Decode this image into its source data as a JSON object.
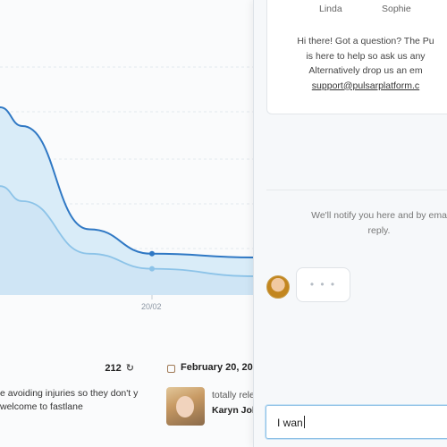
{
  "chart_data": {
    "type": "area",
    "x_ticks": [
      "20/02"
    ],
    "title": "",
    "xlabel": "",
    "ylabel": "",
    "series": [
      {
        "values": [
          1.0,
          0.9,
          0.35,
          0.22,
          0.2
        ]
      },
      {
        "values": [
          0.58,
          0.5,
          0.22,
          0.14,
          0.1
        ]
      }
    ],
    "colors": {
      "line_main": "#2f78c4",
      "line_secondary": "#8cc3e8",
      "area": "#d9ecf8"
    },
    "grid": true
  },
  "feed": {
    "post1": {
      "count": "212",
      "retweet_icon": "retweet-icon",
      "text": "e avoiding injuries so they don't y welcome to fastlane"
    },
    "post2": {
      "icon": "instagram-icon",
      "date": "February 20, 201",
      "snippet": "totally rele",
      "author": "Karyn Joh"
    }
  },
  "chat": {
    "agents": [
      "Linda",
      "Sophie"
    ],
    "welcome_lines": [
      "Hi there! Got a question? The Pu",
      "is here to help so ask us any",
      "Alternatively drop us an em"
    ],
    "email": "support@pulsarplatform.c",
    "notify_lines": [
      "We'll notify you here and by ema",
      "reply."
    ],
    "typing_indicator": "• • •",
    "composer_value": "I wan"
  }
}
